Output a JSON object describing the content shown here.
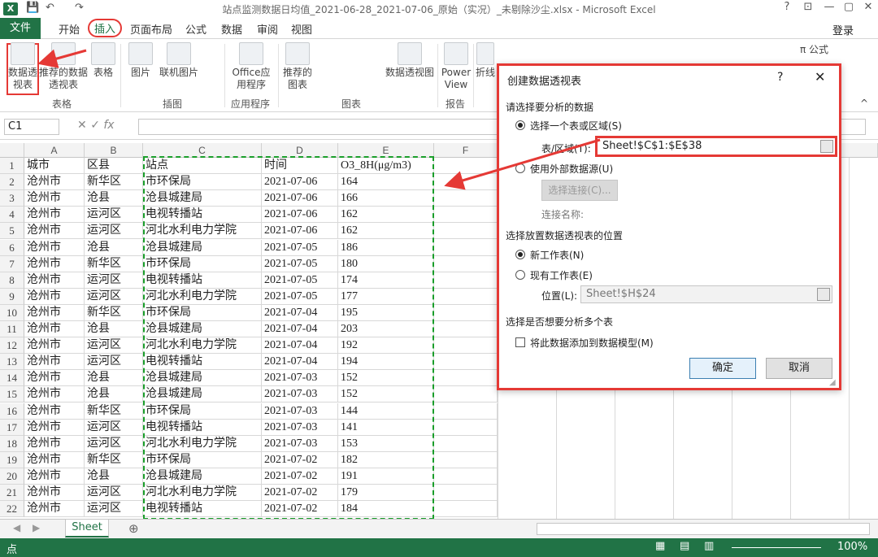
{
  "title_bar": {
    "app_icon": "X",
    "title": "站点监测数据日均值_2021-06-28_2021-07-06_原始（实况）_未剔除沙尘.xlsx - Microsoft Excel",
    "help": "?",
    "minimize": "—",
    "restore": "▢",
    "close": "✕"
  },
  "tabs": {
    "file": "文件",
    "home": "开始",
    "insert": "插入",
    "page_layout": "页面布局",
    "formulas": "公式",
    "data": "数据",
    "review": "审阅",
    "view": "视图",
    "login": "登录"
  },
  "ribbon": {
    "pivot_table": "数据透视表",
    "recommended_pivot": "推荐的数据透视表",
    "table": "表格",
    "picture": "图片",
    "online_picture": "联机图片",
    "office_apps": "Office应用程序",
    "recommended_charts": "推荐的图表",
    "pivot_chart": "数据透视图",
    "power_view": "Power View",
    "line": "折线",
    "formula": "公式",
    "groups": {
      "tables": "表格",
      "illustrations": "插图",
      "apps": "应用程序",
      "charts": "图表",
      "reports": "报告"
    }
  },
  "formula_bar": {
    "name_box": "C1",
    "value": ""
  },
  "sheet": {
    "columns": [
      "A",
      "B",
      "C",
      "D",
      "E",
      "F"
    ],
    "rows": [
      [
        "城市",
        "区县",
        "站点",
        "时间",
        "O3_8H(μg/m3)"
      ],
      [
        "沧州市",
        "新华区",
        "市环保局",
        "2021-07-06",
        "164"
      ],
      [
        "沧州市",
        "沧县",
        "沧县城建局",
        "2021-07-06",
        "166"
      ],
      [
        "沧州市",
        "运河区",
        "电视转播站",
        "2021-07-06",
        "162"
      ],
      [
        "沧州市",
        "运河区",
        "河北水利电力学院",
        "2021-07-06",
        "162"
      ],
      [
        "沧州市",
        "沧县",
        "沧县城建局",
        "2021-07-05",
        "186"
      ],
      [
        "沧州市",
        "新华区",
        "市环保局",
        "2021-07-05",
        "180"
      ],
      [
        "沧州市",
        "运河区",
        "电视转播站",
        "2021-07-05",
        "174"
      ],
      [
        "沧州市",
        "运河区",
        "河北水利电力学院",
        "2021-07-05",
        "177"
      ],
      [
        "沧州市",
        "新华区",
        "市环保局",
        "2021-07-04",
        "195"
      ],
      [
        "沧州市",
        "沧县",
        "沧县城建局",
        "2021-07-04",
        "203"
      ],
      [
        "沧州市",
        "运河区",
        "河北水利电力学院",
        "2021-07-04",
        "192"
      ],
      [
        "沧州市",
        "运河区",
        "电视转播站",
        "2021-07-04",
        "194"
      ],
      [
        "沧州市",
        "沧县",
        "沧县城建局",
        "2021-07-03",
        "152"
      ],
      [
        "沧州市",
        "沧县",
        "沧县城建局",
        "2021-07-03",
        "152"
      ],
      [
        "沧州市",
        "新华区",
        "市环保局",
        "2021-07-03",
        "144"
      ],
      [
        "沧州市",
        "运河区",
        "电视转播站",
        "2021-07-03",
        "141"
      ],
      [
        "沧州市",
        "运河区",
        "河北水利电力学院",
        "2021-07-03",
        "153"
      ],
      [
        "沧州市",
        "新华区",
        "市环保局",
        "2021-07-02",
        "182"
      ],
      [
        "沧州市",
        "沧县",
        "沧县城建局",
        "2021-07-02",
        "191"
      ],
      [
        "沧州市",
        "运河区",
        "河北水利电力学院",
        "2021-07-02",
        "179"
      ],
      [
        "沧州市",
        "运河区",
        "电视转播站",
        "2021-07-02",
        "184"
      ]
    ],
    "tab_name": "Sheet"
  },
  "status_bar": {
    "mode": "点",
    "zoom": "100%"
  },
  "dialog": {
    "title": "创建数据透视表",
    "help": "?",
    "close": "✕",
    "section1": "请选择要分析的数据",
    "opt_table": "选择一个表或区域(S)",
    "range_label": "表/区域(T):",
    "range_value": "Sheet!$C$1:$E$38",
    "opt_external": "使用外部数据源(U)",
    "choose_conn": "选择连接(C)...",
    "conn_name": "连接名称:",
    "section2": "选择放置数据透视表的位置",
    "opt_new": "新工作表(N)",
    "opt_existing": "现有工作表(E)",
    "loc_label": "位置(L):",
    "loc_value": "Sheet!$H$24",
    "section3": "选择是否想要分析多个表",
    "add_model": "将此数据添加到数据模型(M)",
    "ok": "确定",
    "cancel": "取消"
  },
  "colors": {
    "excel_green": "#217346",
    "highlight_red": "#e53935",
    "selection_green": "#1a9e2a"
  }
}
